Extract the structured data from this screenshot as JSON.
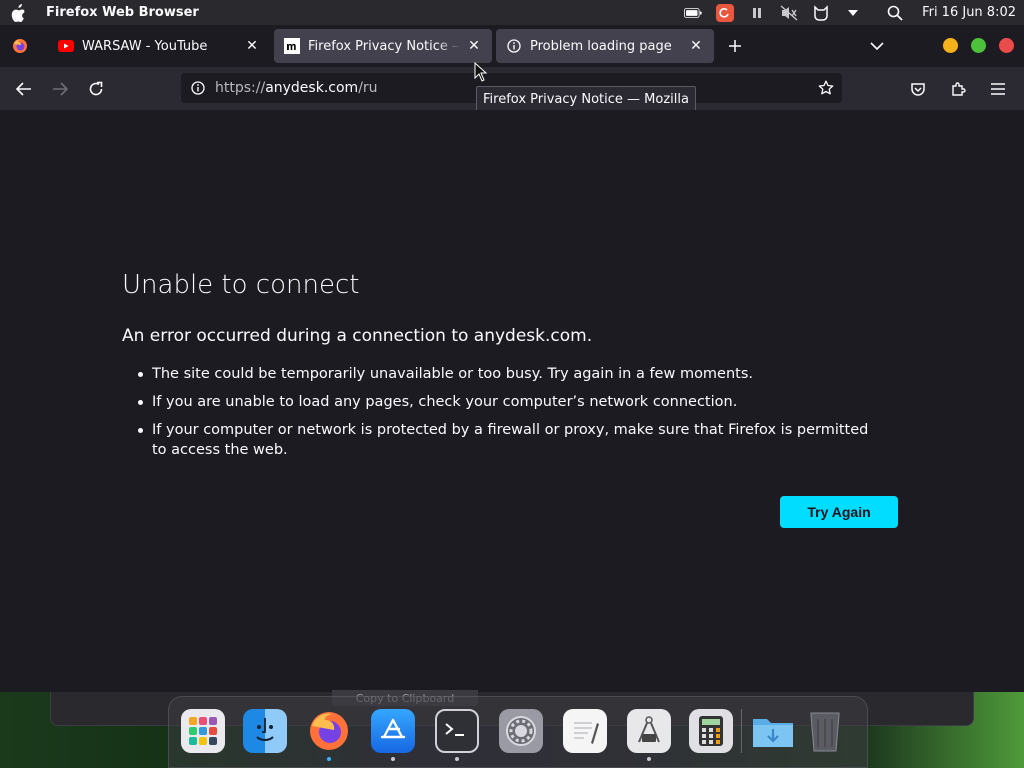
{
  "menubar": {
    "app_name": "Firefox Web Browser",
    "clock": "Fri 16 Jun  8:02"
  },
  "tabs": [
    {
      "title": "WARSAW - YouTube",
      "icon": "youtube-icon"
    },
    {
      "title": "Firefox Privacy Notice — Mozilla",
      "icon": "mozilla-m-icon"
    },
    {
      "title": "Problem loading page",
      "icon": "info-icon"
    }
  ],
  "navbar": {
    "url_prefix": "https://",
    "url_host": "anydesk.com",
    "url_path": "/ru"
  },
  "tooltip": "Firefox Privacy Notice — Mozilla",
  "error": {
    "title": "Unable to connect",
    "short": "An error occurred during a connection to anydesk.com.",
    "items": [
      "The site could be temporarily unavailable or too busy. Try again in a few moments.",
      "If you are unable to load any pages, check your computer’s network connection.",
      "If your computer or network is protected by a firewall or proxy, make sure that Firefox is permitted to access the web."
    ],
    "try_again": "Try Again"
  },
  "desktop": {
    "clipboard_chip": "Copy to Clipboard"
  },
  "dock": {
    "items": [
      "launchpad-icon",
      "finder-icon",
      "firefox-icon",
      "app-store-icon",
      "terminal-icon",
      "system-settings-icon",
      "text-editor-icon",
      "screenshot-tool-icon",
      "calculator-icon",
      "downloads-folder-icon",
      "trash-icon"
    ]
  },
  "colors": {
    "accent": "#00ddff",
    "background": "#1c1b22",
    "toolbar": "#2b2a33",
    "tab_selected": "#42414d",
    "win_minimize": "#f5b11a",
    "win_maximize": "#4cc13a",
    "win_close": "#ea4b4b"
  }
}
